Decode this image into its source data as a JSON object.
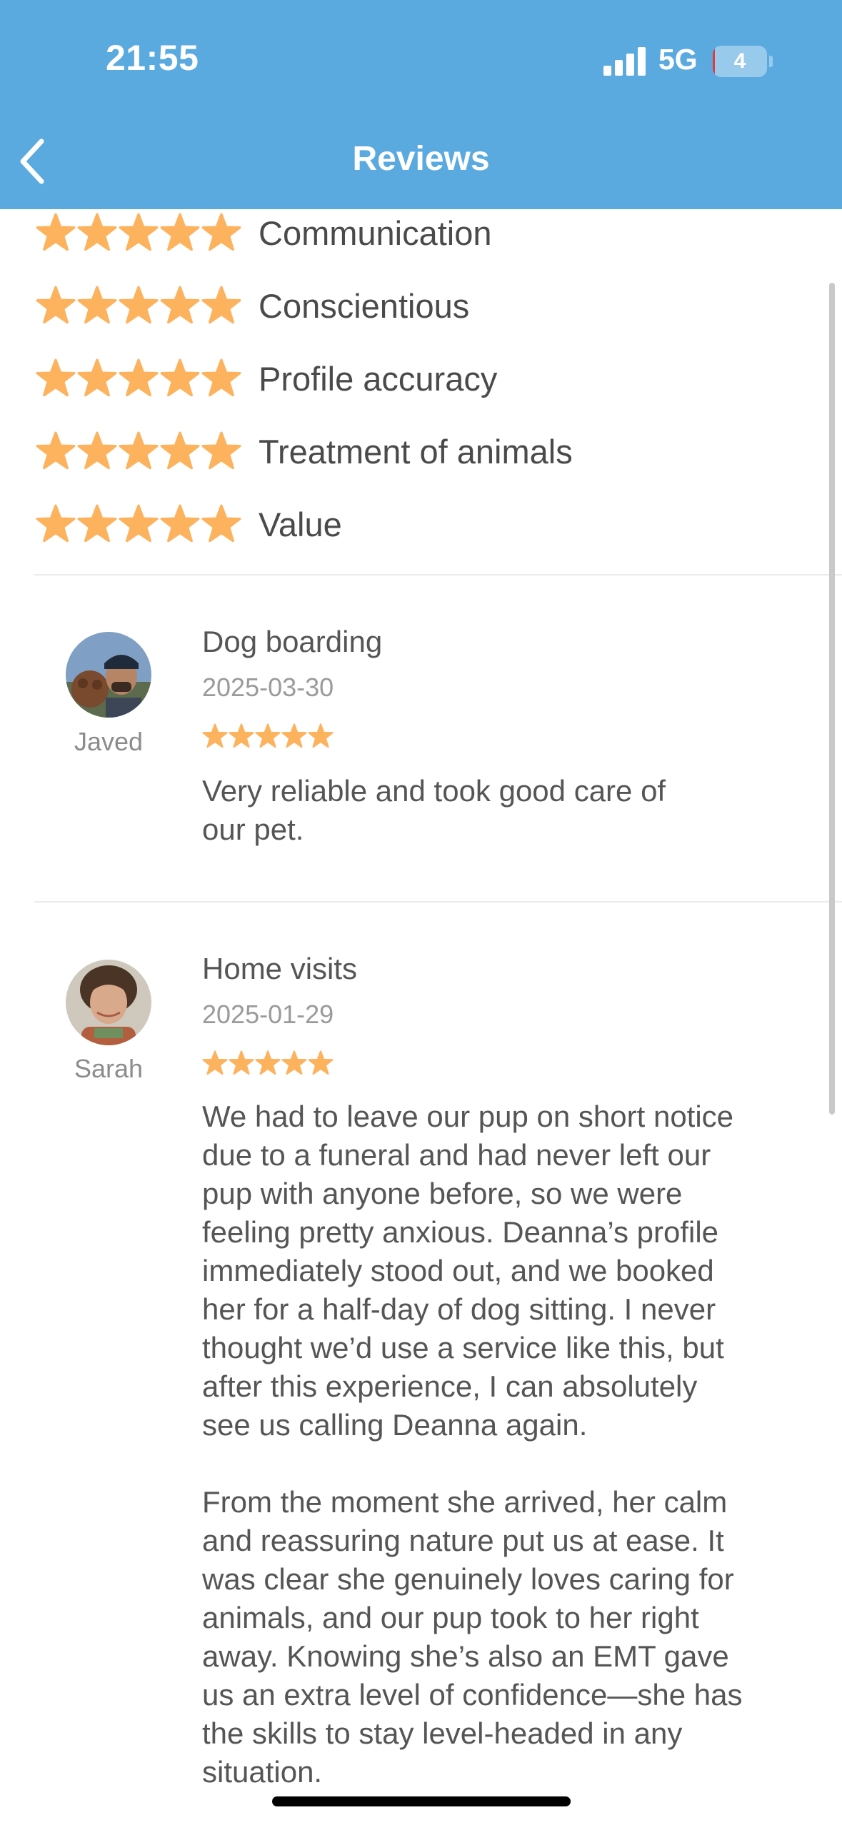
{
  "status_bar": {
    "time": "21:55",
    "network": "5G",
    "battery_level": "4",
    "battery_fraction": 0.04,
    "colors": {
      "battery_low": "#e23b3b"
    }
  },
  "header": {
    "title": "Reviews",
    "back_icon": "chevron-left-icon",
    "background": "#5aaae0"
  },
  "rating_categories": [
    {
      "label": "Communication",
      "stars": 5
    },
    {
      "label": "Conscientious",
      "stars": 5
    },
    {
      "label": "Profile accuracy",
      "stars": 5
    },
    {
      "label": "Treatment of animals",
      "stars": 5
    },
    {
      "label": "Value",
      "stars": 5
    }
  ],
  "star_color": "#fdb25d",
  "reviews": [
    {
      "reviewer": "Javed",
      "service": "Dog boarding",
      "date": "2025-03-30",
      "stars": 5,
      "text": "Very reliable and took good care of\nour pet."
    },
    {
      "reviewer": "Sarah",
      "service": "Home visits",
      "date": "2025-01-29",
      "stars": 5,
      "text": "We had to leave our pup on short notice\ndue to a funeral and had never left our\npup with anyone before, so we were\nfeeling pretty anxious. Deanna’s profile\nimmediately stood out, and we booked\nher for a half-day of dog sitting. I never\nthought we’d use a service like this, but\nafter this experience, I can absolutely\nsee us calling Deanna again.\n\nFrom the moment she arrived, her calm\nand reassuring nature put us at ease. It\nwas clear she genuinely loves caring for\nanimals, and our pup took to her right\naway. Knowing she’s also an EMT gave\nus an extra level of confidence—she has\nthe skills to stay level-headed in any\nsituation."
    }
  ]
}
